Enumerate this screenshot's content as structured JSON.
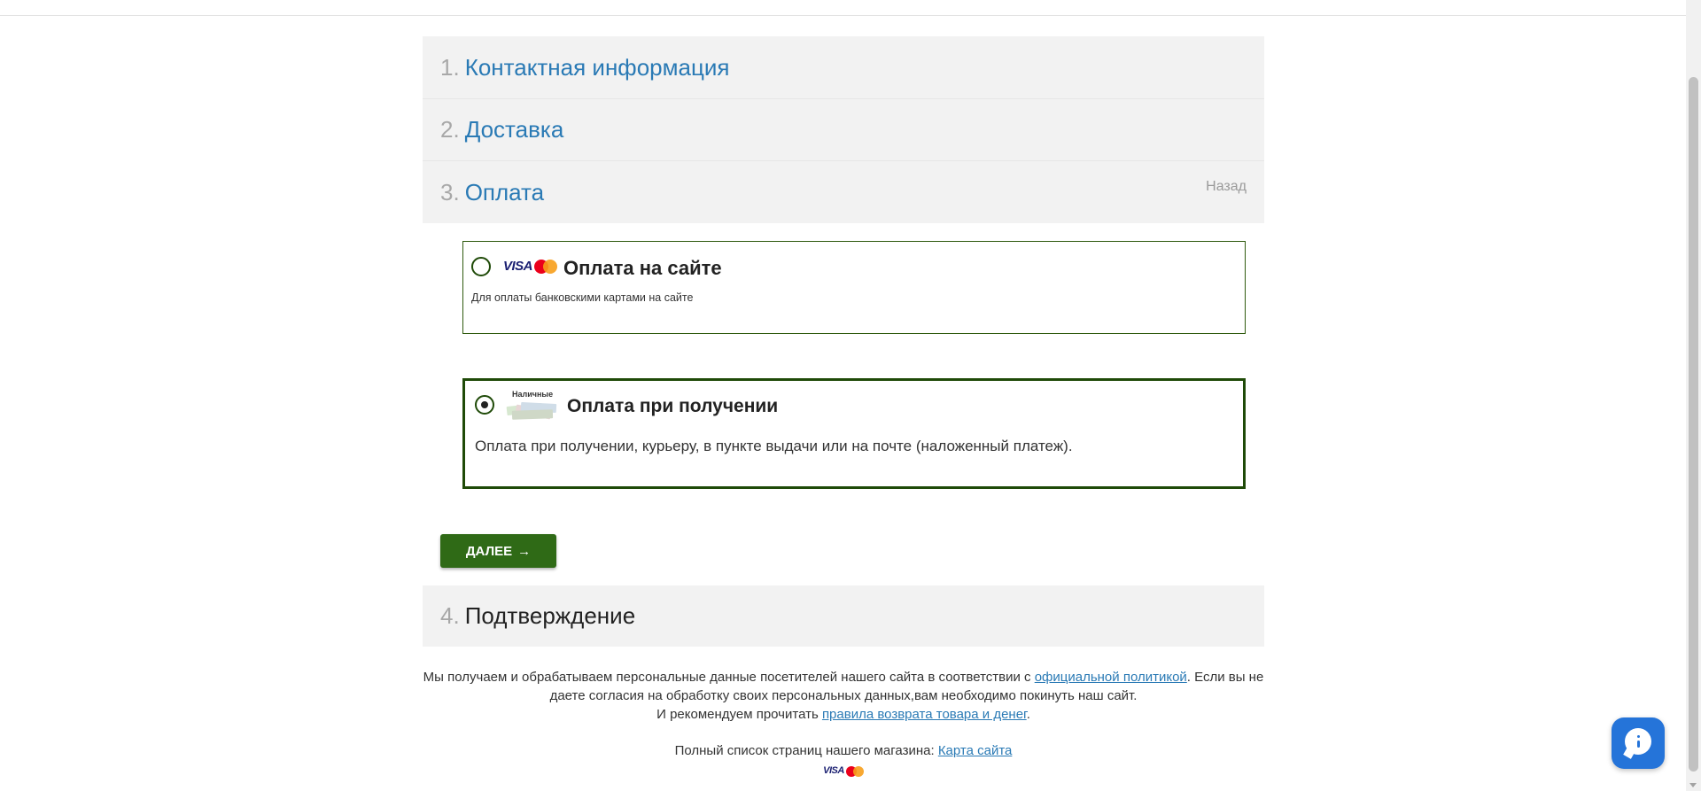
{
  "steps": [
    {
      "num": "1.",
      "title": "Контактная информация"
    },
    {
      "num": "2.",
      "title": "Доставка"
    },
    {
      "num": "3.",
      "title": "Оплата",
      "back_label": "Назад"
    },
    {
      "num": "4.",
      "title": "Подтверждение"
    }
  ],
  "payment_options": [
    {
      "title": "Оплата на сайте",
      "description": "Для оплаты банковскими картами на сайте",
      "logo_text": "VISA",
      "selected": false
    },
    {
      "title": "Оплата при получении",
      "description": "Оплата при получении, курьеру, в пункте выдачи или на почте (наложенный платеж).",
      "logo_text": "Наличные",
      "selected": true
    }
  ],
  "next_button": {
    "label": "ДАЛЕЕ",
    "arrow": "→"
  },
  "footer": {
    "privacy_text_1": "Мы получаем и обрабатываем персональные данные посетителей нашего сайта в соответствии с ",
    "privacy_link": "официальной политикой",
    "privacy_text_2": ". Если вы не даете согласия на обработку своих персональных данных,вам необходимо покинуть наш сайт.",
    "returns_text": "И рекомендуем прочитать ",
    "returns_link": "правила возврата товара и денег",
    "returns_end": ".",
    "sitemap_text": "Полный список страниц нашего магазина: ",
    "sitemap_link": "Карта сайта",
    "card_logo_text": "VISA"
  },
  "colors": {
    "step_title": "#2a7ab5",
    "accent_green": "#2f6a16",
    "border_green": "#1f4a08",
    "chat_blue": "#2574d9"
  },
  "icons": {
    "chat": "chat-bubble-icon",
    "visa": "visa-mastercard-icon",
    "cash": "cash-icon"
  }
}
